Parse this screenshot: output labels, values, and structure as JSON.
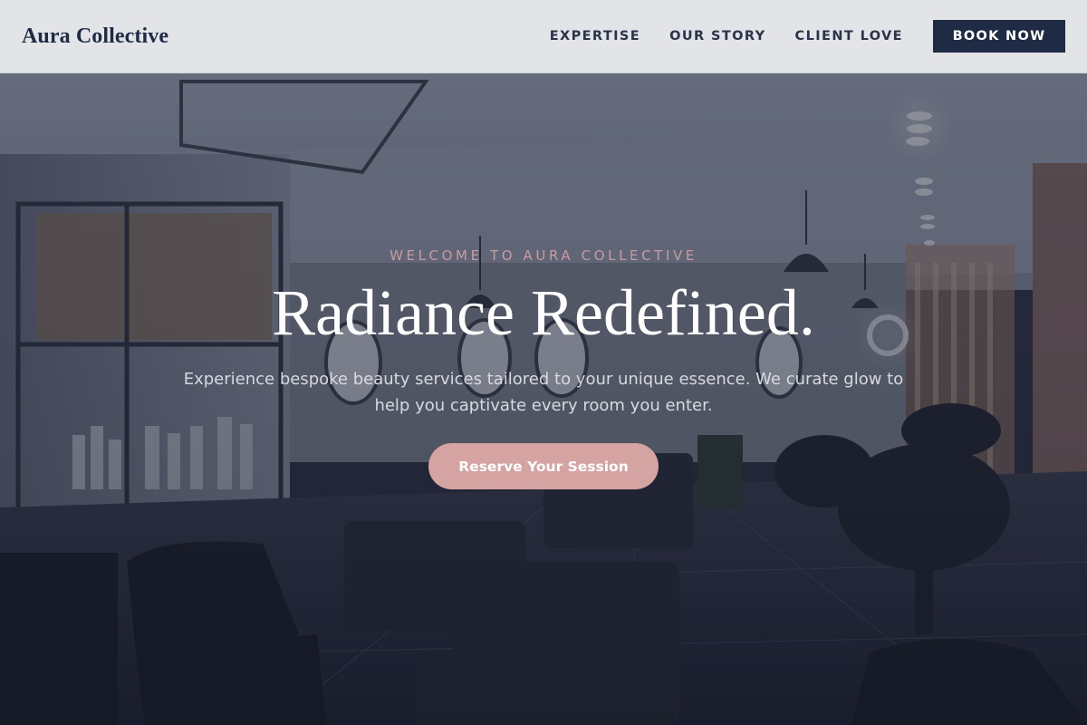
{
  "brand": {
    "name": "Aura Collective"
  },
  "nav": {
    "links": [
      "EXPERTISE",
      "OUR STORY",
      "CLIENT LOVE"
    ],
    "cta_label": "BOOK NOW"
  },
  "hero": {
    "eyebrow": "WELCOME TO AURA COLLECTIVE",
    "headline": "Radiance Redefined.",
    "subtext": "Experience bespoke beauty services tailored to your unique essence. We curate glow to help you captivate every room you enter.",
    "cta_label": "Reserve Your Session",
    "background_image": "salon-interior-photo"
  },
  "colors": {
    "navy": "#1f2a44",
    "rose_accent": "#d4a3a2",
    "eyebrow_rose": "#c79b9f",
    "nav_bg": "#ecedf0"
  }
}
